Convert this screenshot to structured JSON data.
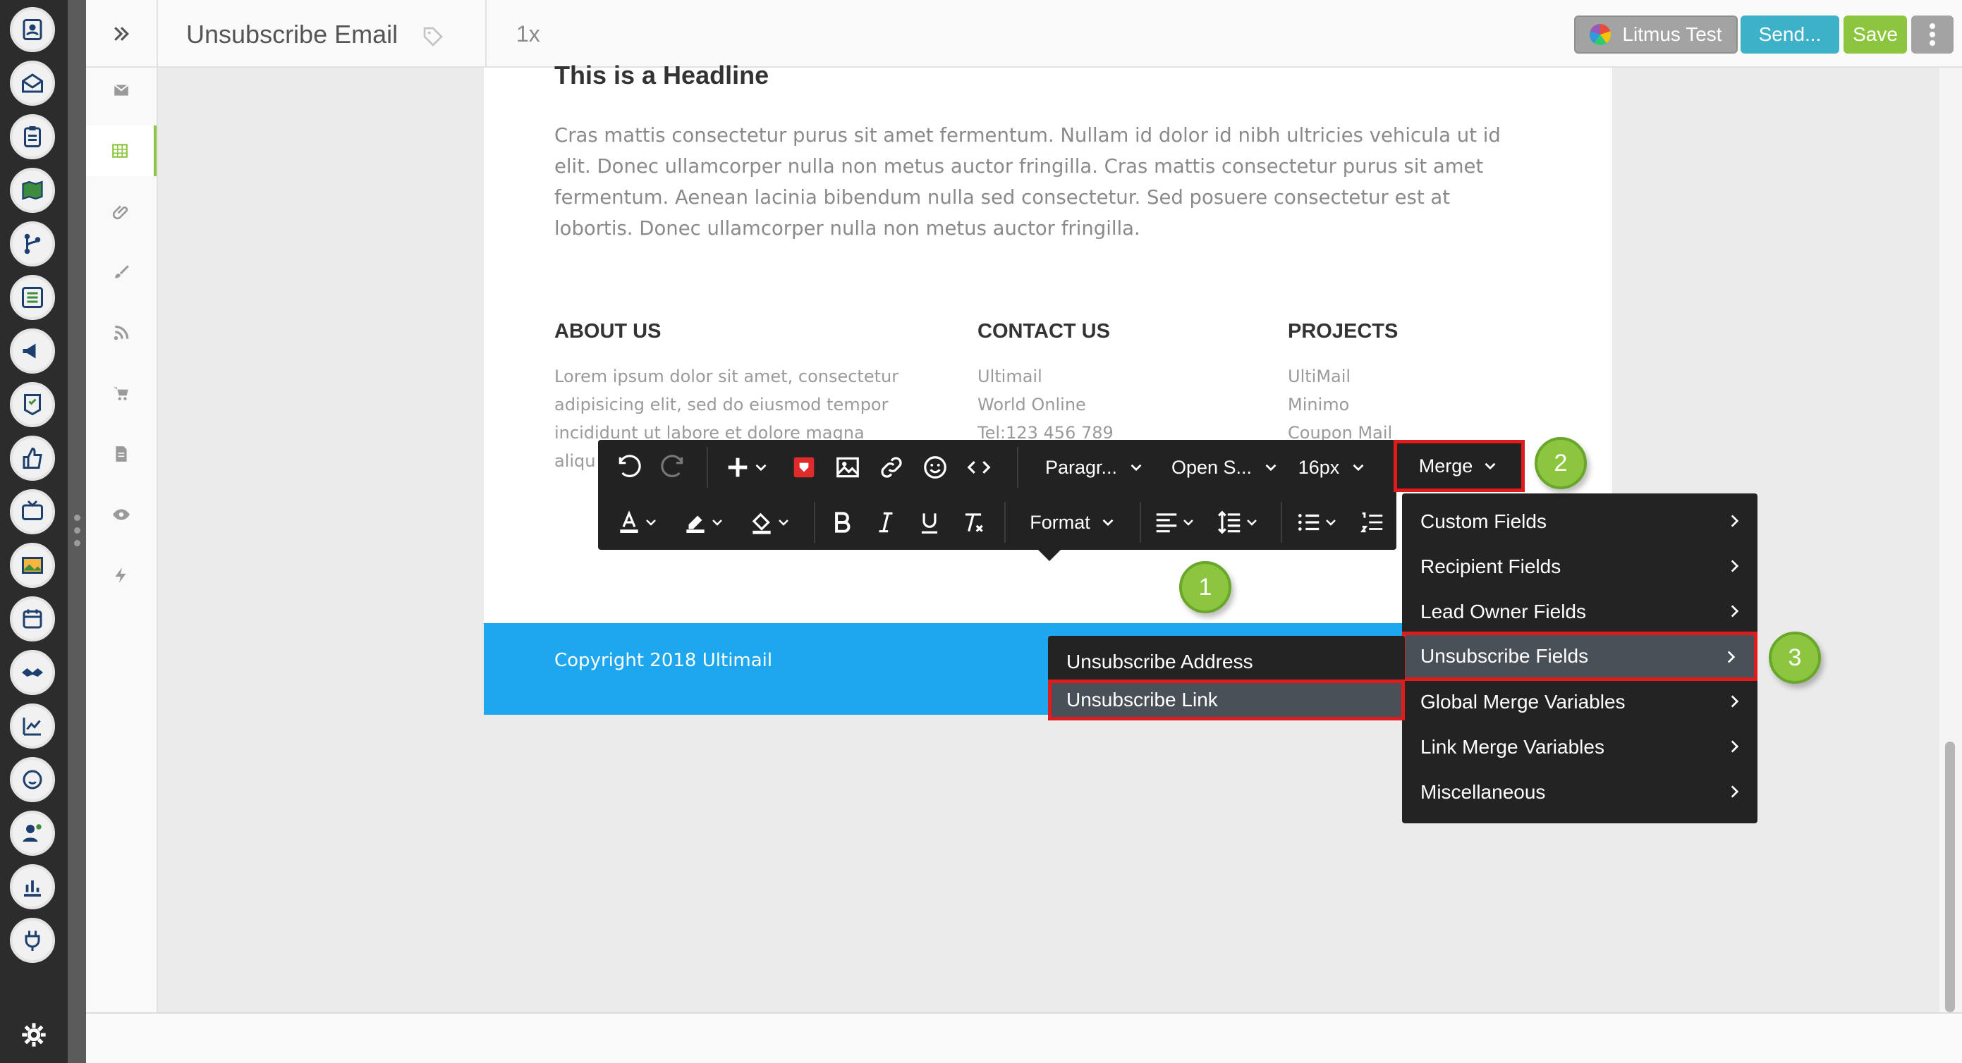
{
  "header": {
    "title": "Unsubscribe Email",
    "zoom": "1x",
    "litmus_label": "Litmus Test",
    "send_label": "Send...",
    "save_label": "Save"
  },
  "email": {
    "headline": "This is a Headline",
    "body": "Cras mattis consectetur purus sit amet fermentum. Nullam id dolor id nibh ultricies vehicula ut id elit. Donec ullamcorper nulla non metus auctor fringilla. Cras mattis consectetur purus sit amet fermentum. Aenean lacinia bibendum nulla sed consectetur. Sed posuere consectetur est at lobortis. Donec ullamcorper nulla non metus auctor fringilla.",
    "columns": [
      {
        "heading": "ABOUT US",
        "lines": [
          "Lorem ipsum dolor sit amet, consectetur",
          "adipisicing elit, sed do eiusmod tempor",
          "incididunt ut labore et dolore magna",
          "aliqu"
        ]
      },
      {
        "heading": "CONTACT US",
        "lines": [
          "Ultimail",
          "World Online",
          "Tel:123 456 789"
        ]
      },
      {
        "heading": "PROJECTS",
        "lines": [
          "UltiMail",
          "Minimo",
          "Coupon Mail"
        ]
      }
    ],
    "copyright": "Copyright 2018 Ultimail"
  },
  "toolbar": {
    "paragraph": "Paragr...",
    "font": "Open S...",
    "size": "16px",
    "merge": "Merge",
    "format": "Format"
  },
  "merge_menu": {
    "items": [
      "Custom Fields",
      "Recipient Fields",
      "Lead Owner Fields",
      "Unsubscribe Fields",
      "Global Merge Variables",
      "Link Merge Variables",
      "Miscellaneous"
    ],
    "active_index": 3
  },
  "sub_menu": {
    "items": [
      "Unsubscribe Address",
      "Unsubscribe Link"
    ],
    "active_index": 1
  },
  "callouts": [
    "1",
    "2",
    "3"
  ],
  "colors": {
    "accent_green": "#8cc63f",
    "send_blue": "#3db1c8",
    "footer_blue": "#1ea7ef",
    "highlight_red": "#e11b1b"
  }
}
